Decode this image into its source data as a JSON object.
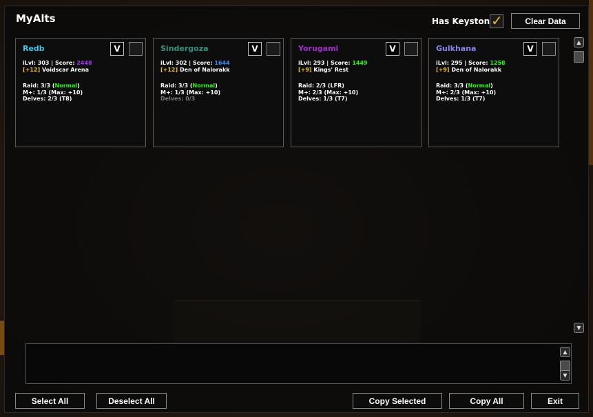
{
  "window": {
    "title": "MyAlts"
  },
  "header": {
    "keystone_label": "Has Keystone",
    "keystone_checked": true,
    "clear_data_label": "Clear Data"
  },
  "characters": [
    {
      "name": "Redb",
      "name_color": "#3fc7eb",
      "ilvl_line": "iLvl: 303  |  Score: ",
      "score": "2448",
      "score_color": "#a335ee",
      "key_level": "[+12]",
      "key_dungeon": "Voidscar Arena",
      "raid_prefix": "Raid: 3/3 (",
      "raid_diff": "Normal",
      "raid_suffix": ")",
      "raid_diff_color": "#1eff00",
      "mplus": "M+: 1/3 (Max: +10)",
      "delves": "Delves: 2/3 (T8)",
      "delves_dim": false,
      "v_label": "V"
    },
    {
      "name": "Sindergoza",
      "name_color": "#33937f",
      "ilvl_line": "iLvl: 302  |  Score: ",
      "score": "1644",
      "score_color": "#2b8fff",
      "key_level": "[+12]",
      "key_dungeon": "Den of Nalorakk",
      "raid_prefix": "Raid: 3/3 (",
      "raid_diff": "Normal",
      "raid_suffix": ")",
      "raid_diff_color": "#1eff00",
      "mplus": "M+: 1/3 (Max: +10)",
      "delves": "Delves: 0/3",
      "delves_dim": true,
      "v_label": "V"
    },
    {
      "name": "Yorugami",
      "name_color": "#a330c9",
      "ilvl_line": "iLvl: 293  |  Score: ",
      "score": "1449",
      "score_color": "#1eff00",
      "key_level": "[+9]",
      "key_dungeon": "Kings' Rest",
      "raid_prefix": "Raid: 2/3 (LFR)",
      "raid_diff": "",
      "raid_suffix": "",
      "raid_diff_color": "#ffffff",
      "mplus": "M+: 2/3 (Max: +10)",
      "delves": "Delves: 1/3 (T7)",
      "delves_dim": false,
      "v_label": "V"
    },
    {
      "name": "Gulkhana",
      "name_color": "#8788ee",
      "ilvl_line": "iLvl: 295  |  Score: ",
      "score": "1258",
      "score_color": "#1eff00",
      "key_level": "[+9]",
      "key_dungeon": "Den of Nalorakk",
      "raid_prefix": "Raid: 3/3 (",
      "raid_diff": "Normal",
      "raid_suffix": ")",
      "raid_diff_color": "#1eff00",
      "mplus": "M+: 2/3 (Max: +10)",
      "delves": "Delves: 1/3 (T7)",
      "delves_dim": false,
      "v_label": "V"
    }
  ],
  "footer": {
    "select_all": "Select All",
    "deselect_all": "Deselect All",
    "copy_selected": "Copy Selected",
    "copy_all": "Copy All",
    "exit": "Exit"
  },
  "icons": {
    "scroll_up": "scroll-up-icon",
    "scroll_down": "scroll-down-icon",
    "checkmark": "checkmark-icon"
  }
}
